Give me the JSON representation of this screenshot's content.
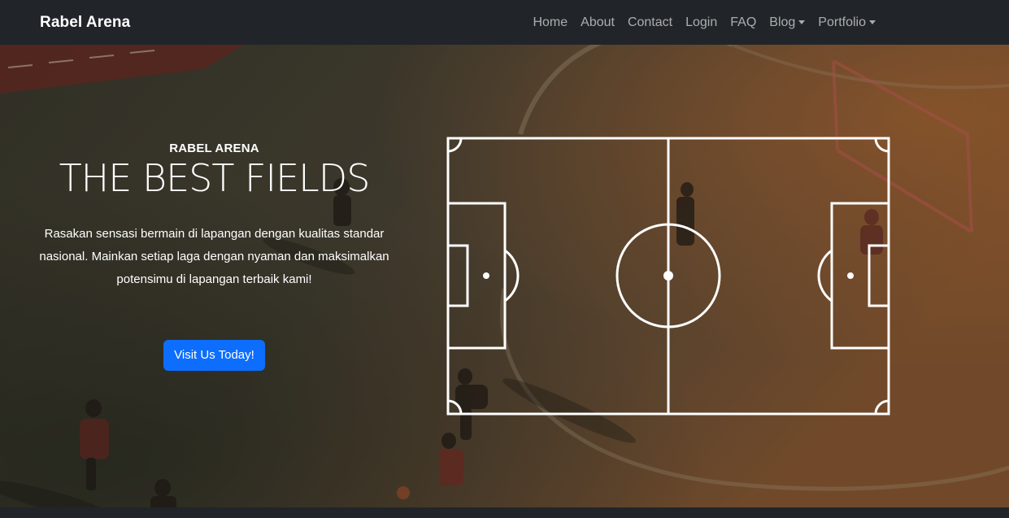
{
  "navbar": {
    "brand": "Rabel Arena",
    "links": [
      {
        "label": "Home",
        "dropdown": false
      },
      {
        "label": "About",
        "dropdown": false
      },
      {
        "label": "Contact",
        "dropdown": false
      },
      {
        "label": "Login",
        "dropdown": false
      },
      {
        "label": "FAQ",
        "dropdown": false
      },
      {
        "label": "Blog",
        "dropdown": true
      },
      {
        "label": "Portfolio",
        "dropdown": true
      }
    ]
  },
  "hero": {
    "eyebrow": "RABEL ARENA",
    "headline": "THE BEST FIELDS",
    "lead": "Rasakan sensasi bermain di lapangan dengan kualitas standar nasional. Mainkan setiap laga dengan nyaman dan maksimalkan potensimu di lapangan terbaik kami!",
    "cta_label": "Visit Us Today!"
  },
  "colors": {
    "navbar_bg": "#212529",
    "nav_text": "rgba(255,255,255,0.62)",
    "brand_text": "#ffffff",
    "cta_bg": "#0d6efd",
    "pitch_lines": "#ffffff"
  },
  "icons": {
    "dropdown": "caret-down-icon",
    "pitch": "football-pitch-icon"
  }
}
